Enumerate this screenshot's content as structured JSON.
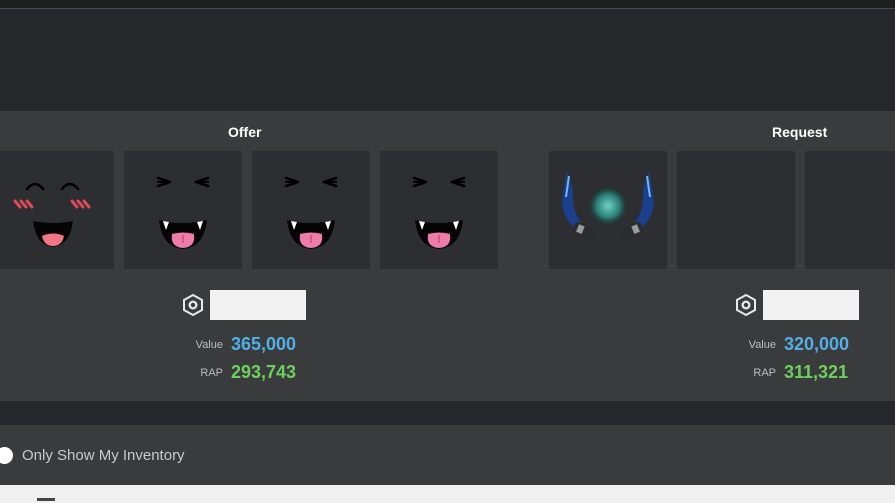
{
  "offer": {
    "title": "Offer",
    "value_label": "Value",
    "value": "365,000",
    "rap_label": "RAP",
    "rap": "293,743",
    "items": [
      {
        "icon": "blush-smile-face-icon"
      },
      {
        "icon": "vampire-tongue-face-icon"
      },
      {
        "icon": "vampire-tongue-face-icon"
      },
      {
        "icon": "vampire-tongue-face-icon"
      }
    ]
  },
  "request": {
    "title": "Request",
    "value_label": "Value",
    "value": "320,000",
    "rap_label": "RAP",
    "rap": "311,321",
    "items": [
      {
        "icon": "blue-horns-orb-icon"
      },
      {
        "icon": "empty-slot"
      },
      {
        "icon": "empty-slot"
      }
    ]
  },
  "inventory_toggle": {
    "label": "Only Show My Inventory",
    "checked": false
  },
  "colors": {
    "value": "#52b0e4",
    "rap": "#6fcf5e",
    "panel": "#393b3d",
    "slot": "#2c2e31"
  }
}
